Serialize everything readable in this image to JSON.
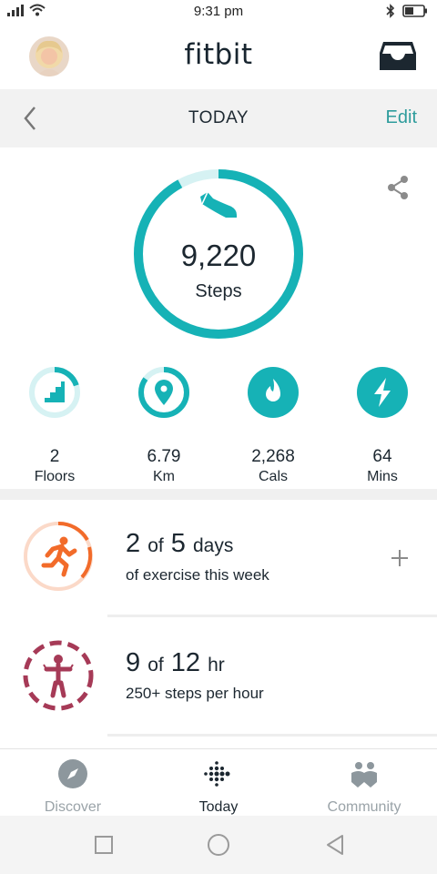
{
  "status_bar": {
    "time": "9:31 pm"
  },
  "header": {
    "logo": "fitbit"
  },
  "nav": {
    "title": "TODAY",
    "edit_label": "Edit"
  },
  "steps": {
    "value": "9,220",
    "label": "Steps",
    "goal_progress": 0.92
  },
  "stats": [
    {
      "value": "2",
      "label": "Floors",
      "icon": "stairs-icon",
      "progress": 0.2
    },
    {
      "value": "6.79",
      "label": "Km",
      "icon": "location-pin-icon",
      "progress": 0.85
    },
    {
      "value": "2,268",
      "label": "Cals",
      "icon": "flame-icon",
      "progress": 1.0
    },
    {
      "value": "64",
      "label": "Mins",
      "icon": "lightning-icon",
      "progress": 1.0
    }
  ],
  "exercise": {
    "count": "2",
    "of": "of",
    "goal": "5",
    "unit": "days",
    "subtitle": "of exercise this week"
  },
  "hourly": {
    "count": "9",
    "of": "of",
    "goal": "12",
    "unit": "hr",
    "subtitle": "250+ steps per hour"
  },
  "tabs": [
    {
      "label": "Discover",
      "icon": "compass-icon"
    },
    {
      "label": "Today",
      "icon": "fitbit-dots-icon",
      "active": true
    },
    {
      "label": "Community",
      "icon": "people-icon"
    }
  ],
  "colors": {
    "teal": "#16b2b6",
    "teal_light": "#d6f2f3",
    "edit": "#2e9c9c",
    "exercise": "#f26b2a",
    "hourly": "#a63a57"
  }
}
